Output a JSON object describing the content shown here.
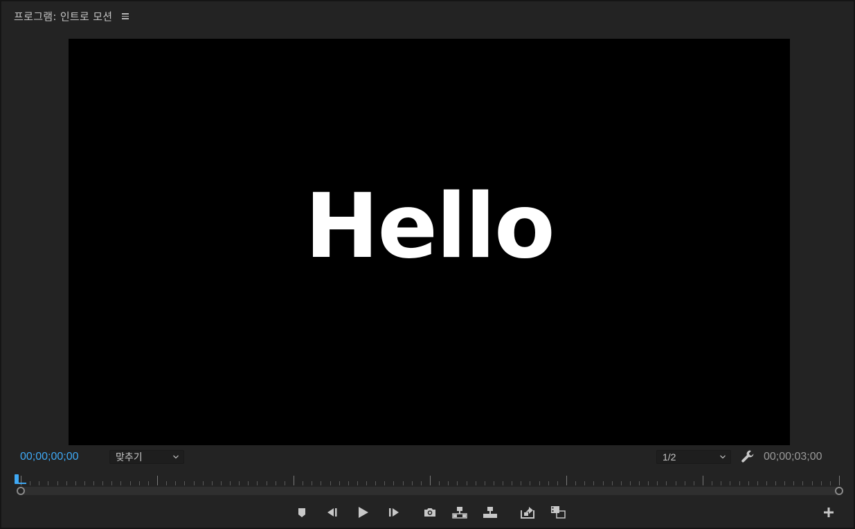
{
  "panel": {
    "title": "프로그램: 인트로 모션"
  },
  "viewer": {
    "frame_text": "Hello"
  },
  "controls": {
    "current_timecode": "00;00;00;00",
    "duration_timecode": "00;00;03;00",
    "zoom_select": "맞추기",
    "resolution_select": "1/2"
  },
  "timeline": {
    "playhead_position": 0
  },
  "transport": {
    "buttons": [
      {
        "id": "add-marker",
        "icon": "marker-icon"
      },
      {
        "id": "step-back",
        "icon": "step-back-icon"
      },
      {
        "id": "play",
        "icon": "play-icon"
      },
      {
        "id": "step-forward",
        "icon": "step-forward-icon"
      },
      {
        "id": "export-frame",
        "icon": "camera-icon"
      },
      {
        "id": "lift",
        "icon": "lift-icon"
      },
      {
        "id": "extract",
        "icon": "extract-icon"
      },
      {
        "id": "insert",
        "icon": "insert-icon"
      },
      {
        "id": "comparison-view",
        "icon": "comparison-view-icon"
      }
    ]
  },
  "colors": {
    "accent": "#3fa9f5",
    "panel_bg": "#232323",
    "viewer_bg": "#000000"
  }
}
